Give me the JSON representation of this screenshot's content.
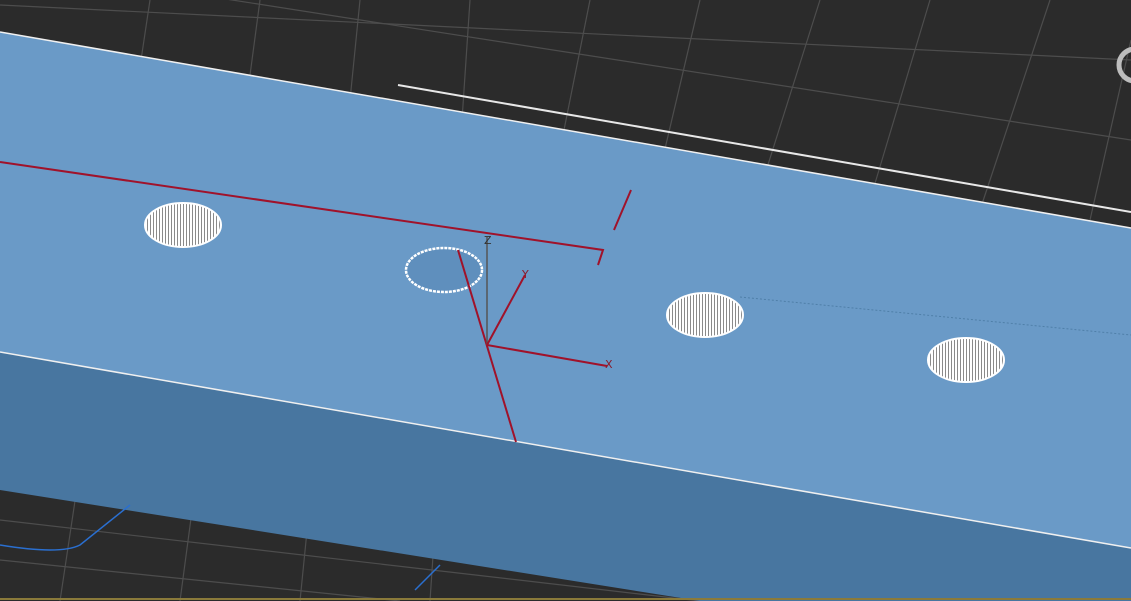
{
  "viewport": {
    "gizmo": {
      "x_label": "X",
      "y_label": "Y",
      "z_label": "Z"
    },
    "colors": {
      "background": "#2b2b2b",
      "grid": "#4a4a4a",
      "top_face": "#6a9ac7",
      "side_face": "#4876a0",
      "axis": "#a0122a",
      "hole": "#ffffff"
    },
    "hole_count": 4
  }
}
